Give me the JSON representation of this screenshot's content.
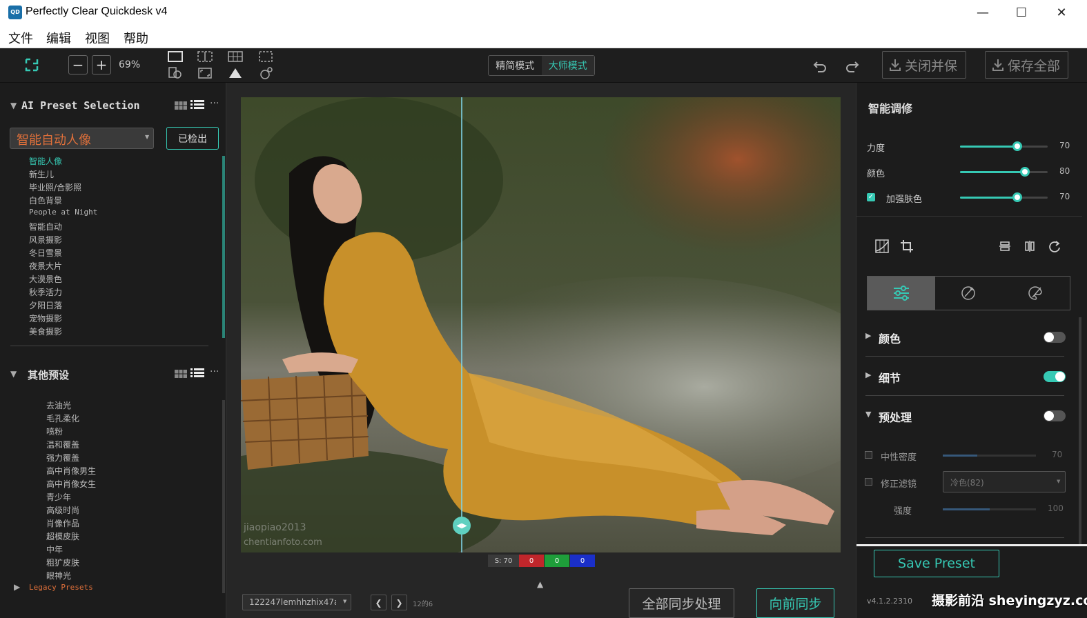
{
  "window": {
    "title": "Perfectly Clear Quickdesk v4",
    "icon_text": "QD",
    "minimize": "—",
    "maximize": "☐",
    "close": "✕"
  },
  "menu": [
    "文件",
    "编辑",
    "视图",
    "帮助"
  ],
  "toolbar": {
    "zoom_out": "−",
    "zoom_in": "+",
    "zoom_level": "69%",
    "mode_simple": "精简模式",
    "mode_master": "大师模式",
    "save_close": "关闭并保",
    "save_all": "保存全部"
  },
  "ai_presets": {
    "title": "AI Preset Selection",
    "selected": "智能自动人像",
    "checked_out_button": "已检出",
    "items": [
      "智能人像",
      "新生儿",
      "毕业照/合影照",
      "白色背景",
      "People at Night",
      "智能自动",
      "风景摄影",
      "冬日雪景",
      "夜景大片",
      "大漠景色",
      "秋季活力",
      "夕阳日落",
      "宠物摄影",
      "美食摄影"
    ]
  },
  "other_presets": {
    "title": "其他预设",
    "items": [
      "去油光",
      "毛孔柔化",
      "喷粉",
      "温和覆盖",
      "强力覆盖",
      "高中肖像男生",
      "高中肖像女生",
      "青少年",
      "高级时尚",
      "肖像作品",
      "超模皮肤",
      "中年",
      "粗犷皮肤",
      "眼神光"
    ],
    "legacy": "Legacy Presets"
  },
  "canvas": {
    "watermark_1": "jiaopiao2013",
    "watermark_2": "chentianfoto.com",
    "stat_s": "S: 70",
    "stat_r": "0",
    "stat_g": "0",
    "stat_b": "0",
    "filename": "122247lemhhzhix47a",
    "page_info": "12的6",
    "sync_all": "全部同步处理",
    "sync_forward": "向前同步"
  },
  "right": {
    "title": "智能调修",
    "sliders": [
      {
        "label": "力度",
        "value": 70,
        "display": "70"
      },
      {
        "label": "颜色",
        "value": 80,
        "display": "80"
      },
      {
        "label": "加强肤色",
        "value": 70,
        "display": "70",
        "checked": true
      }
    ],
    "sections": [
      {
        "label": "颜色",
        "on": false
      },
      {
        "label": "细节",
        "on": true
      },
      {
        "label": "预处理",
        "on": false
      }
    ],
    "sub": {
      "neutral_density": "中性密度",
      "neutral_value": "70",
      "correction_filter": "修正滤镜",
      "filter_option": "冷色(82)",
      "strength": "强度",
      "strength_value": "100"
    },
    "save_preset": "Save Preset",
    "version": "v4.1.2.2310",
    "watermark": "摄影前沿 sheyingzyz.com"
  },
  "colors": {
    "accent": "#36c9b4",
    "background": "#1f1f1f"
  }
}
